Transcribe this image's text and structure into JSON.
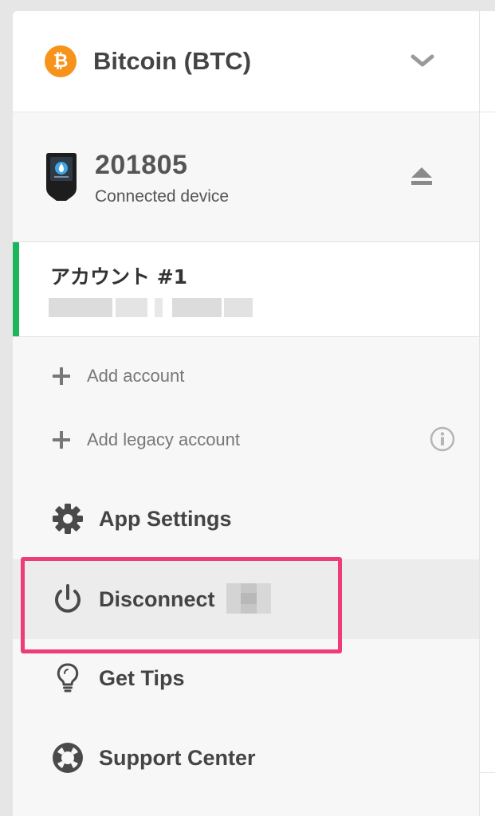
{
  "coin": {
    "name": "Bitcoin (BTC)",
    "icon_glyph": "₿",
    "icon": "bitcoin-icon",
    "accent": "#f7931a"
  },
  "device": {
    "id": "201805",
    "status": "Connected device",
    "icon": "trezor-device-icon"
  },
  "account": {
    "name": "アカウント #1",
    "accent": "#1cb55b"
  },
  "add_actions": [
    {
      "label": "Add account",
      "icon": "plus-icon"
    },
    {
      "label": "Add legacy account",
      "icon": "plus-icon"
    }
  ],
  "menu": [
    {
      "label": "App Settings",
      "icon": "gear-icon"
    },
    {
      "label": "Disconnect",
      "icon": "power-icon",
      "active": true
    },
    {
      "label": "Get Tips",
      "icon": "lightbulb-icon"
    },
    {
      "label": "Support Center",
      "icon": "lifebuoy-icon"
    }
  ],
  "highlight_color": "#ee3c7a"
}
